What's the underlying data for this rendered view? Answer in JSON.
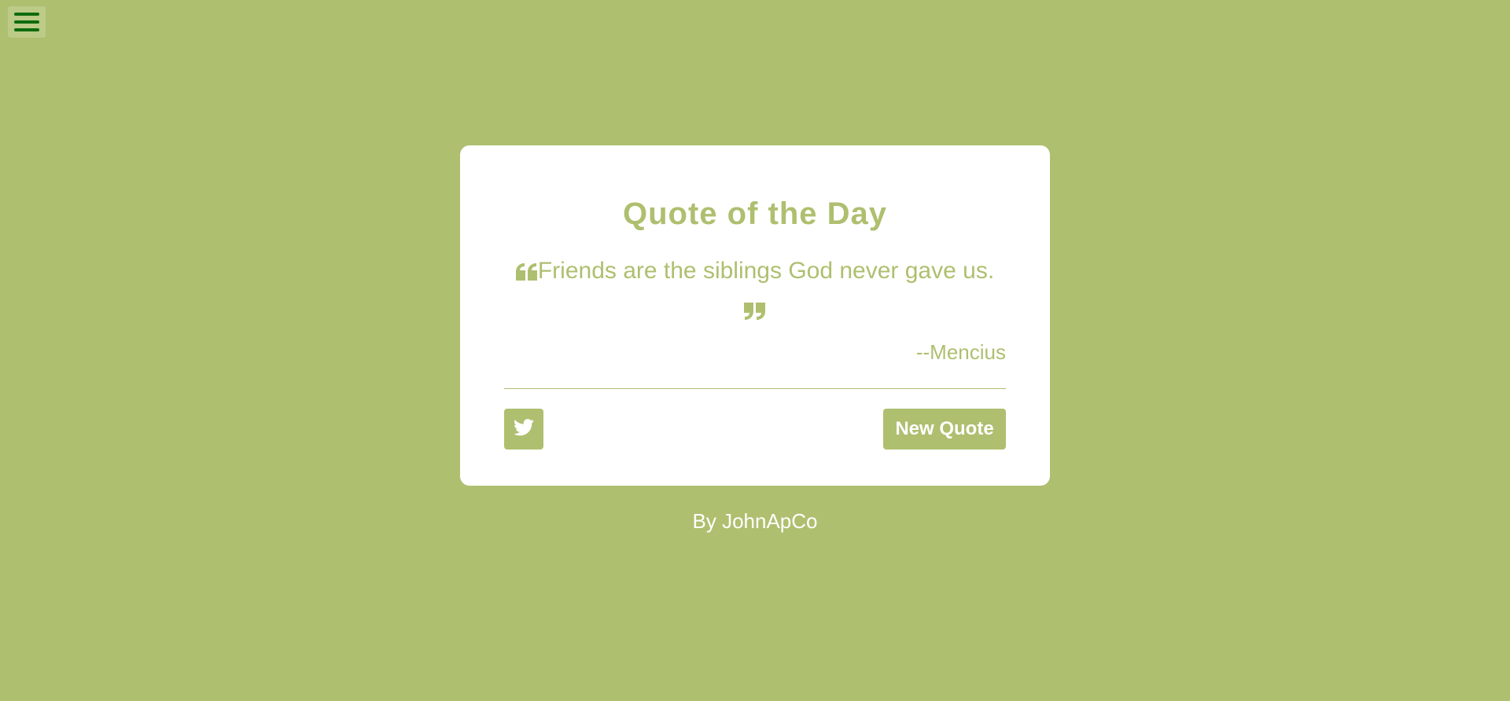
{
  "menu": {
    "icon": "hamburger-menu-icon"
  },
  "card": {
    "title": "Quote of the Day",
    "quote_text": "Friends are the siblings God never gave us.",
    "author": "--Mencius",
    "open_quote_icon": "quote-left-icon",
    "close_quote_icon": "quote-right-icon",
    "tweet_icon": "twitter-icon",
    "new_quote_label": "New Quote"
  },
  "footer": {
    "credit": "By JohnApCo"
  },
  "colors": {
    "background": "#aebf6f",
    "accent": "#aebf6f",
    "card": "#ffffff",
    "menu_bars": "#0d6b0d"
  }
}
